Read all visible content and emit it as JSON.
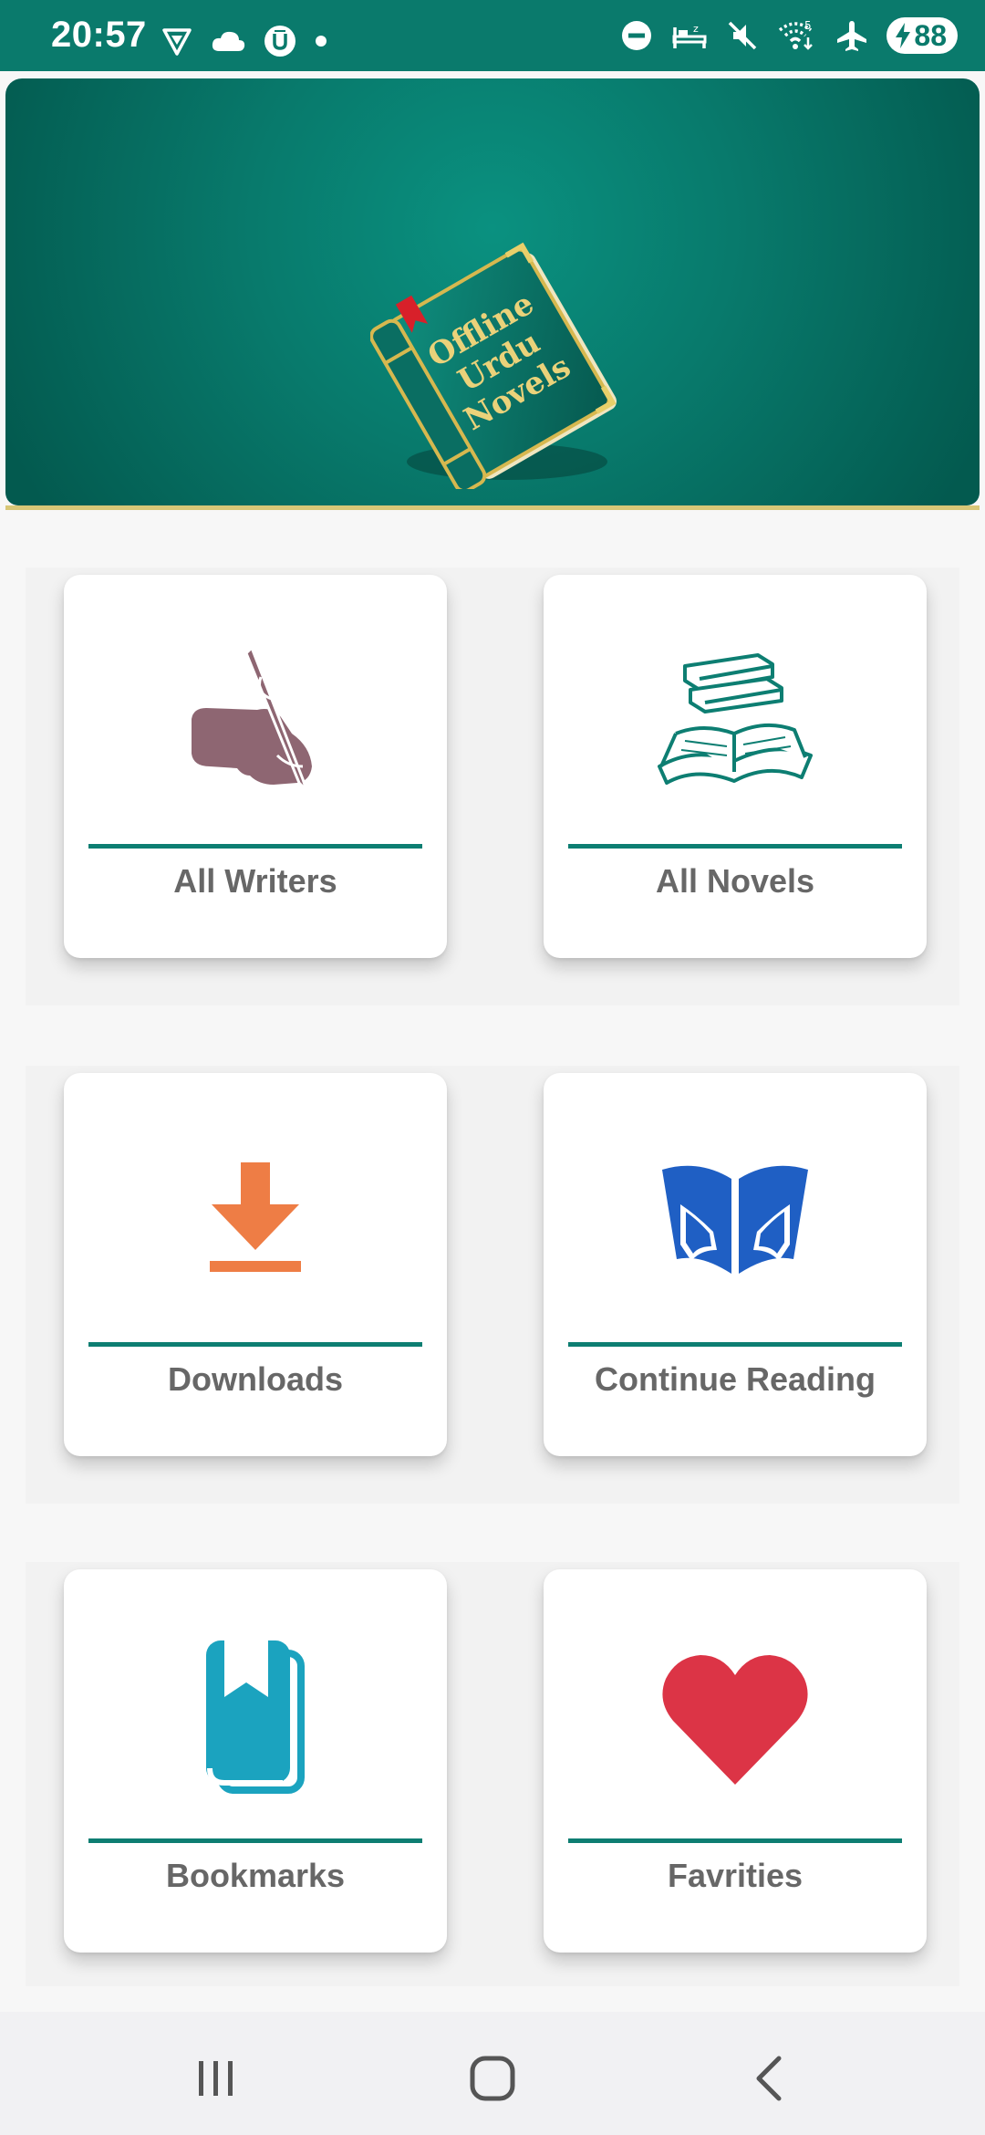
{
  "status_bar": {
    "time": "20:57",
    "battery": "88",
    "left_icons": [
      "vpn-shield-icon",
      "cloud-icon",
      "u-badge-icon",
      "dot-icon"
    ],
    "right_icons": [
      "do-not-disturb-icon",
      "bedtime-icon",
      "mute-icon",
      "wifi-icon",
      "airplane-icon"
    ]
  },
  "banner": {
    "logo_text": [
      "Offline",
      "Urdu",
      "Novels"
    ],
    "accent_color": "#d8c777"
  },
  "menu": [
    {
      "label": "All Writers",
      "icon": "hand-writing-pen-icon",
      "color": "#8e6672"
    },
    {
      "label": "All Novels",
      "icon": "stack-of-books-icon",
      "color": "#0d7e72"
    },
    {
      "label": "Downloads",
      "icon": "download-icon",
      "color": "#ee7d45"
    },
    {
      "label": "Continue Reading",
      "icon": "reading-book-icon",
      "color": "#1f5fc4"
    },
    {
      "label": "Bookmarks",
      "icon": "bookmark-book-icon",
      "color": "#1ba3bf"
    },
    {
      "label": "Favrities",
      "icon": "heart-icon",
      "color": "#dc3446"
    }
  ],
  "theme": {
    "primary": "#0a7a6c",
    "divider": "#0d7e72",
    "label_color": "#676767"
  },
  "nav_bar": {
    "buttons": [
      "recents-button",
      "home-button",
      "back-button"
    ]
  }
}
